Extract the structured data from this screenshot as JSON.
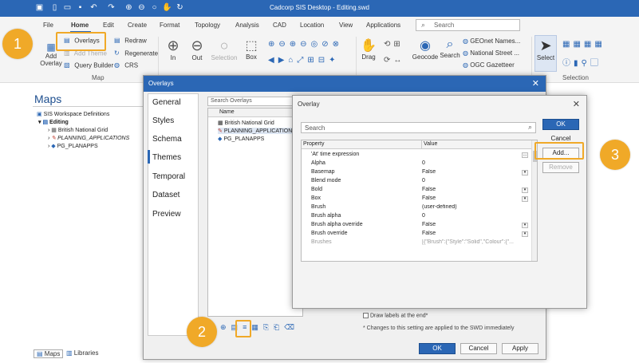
{
  "window": {
    "title": "Cadcorp SIS Desktop - Editing.swd"
  },
  "menu": {
    "items": [
      "File",
      "Home",
      "Edit",
      "Create",
      "Format",
      "Topology",
      "Analysis",
      "CAD",
      "Location",
      "View",
      "Applications"
    ],
    "active": "Home",
    "search_placeholder": "Search"
  },
  "ribbon": {
    "add_overlay": "Add\nOverlay",
    "overlays": "Overlays",
    "add_theme": "Add Theme",
    "query_builder": "Query Builder",
    "redraw": "Redraw",
    "regenerate": "Regenerate",
    "crs": "CRS",
    "map_group": "Map",
    "in": "In",
    "out": "Out",
    "selection": "Selection",
    "box": "Box",
    "drag": "Drag",
    "geocode": "Geocode",
    "search": "Search",
    "geo_items": [
      "GEOnet Names...",
      "National Street ...",
      "OGC Gazetteer"
    ],
    "select": "Select",
    "selection_group": "Selection"
  },
  "maps_panel": {
    "title": "Maps",
    "tree": [
      "SIS Workspace Definitions",
      "Editing",
      "British National Grid",
      "PLANNING_APPLICATIONS",
      "PG_PLANAPPS"
    ],
    "tabs": [
      "Maps",
      "Libraries"
    ]
  },
  "overlays_dialog": {
    "title": "Overlays",
    "nav": [
      "General",
      "Styles",
      "Schema",
      "Themes",
      "Temporal",
      "Dataset",
      "Preview"
    ],
    "selected_nav": "Themes",
    "search_placeholder": "Search Overlays",
    "list_header": "Name",
    "list_items": [
      "British National Grid",
      "PLANNING_APPLICATIONS",
      "PG_PLANAPPS"
    ],
    "draw_labels": "Draw labels at the end*",
    "note": "* Changes to this setting are applied to the SWD immediately",
    "ok": "OK",
    "cancel": "Cancel",
    "apply": "Apply"
  },
  "overlay_dialog": {
    "title": "Overlay",
    "search_placeholder": "Search",
    "col_property": "Property",
    "col_value": "Value",
    "rows": [
      {
        "p": "'At' time expression",
        "v": ""
      },
      {
        "p": "Alpha",
        "v": "0"
      },
      {
        "p": "Basemap",
        "v": "False"
      },
      {
        "p": "Blend mode",
        "v": "0"
      },
      {
        "p": "Bold",
        "v": "False"
      },
      {
        "p": "Box",
        "v": "False"
      },
      {
        "p": "Brush",
        "v": "(user-defined)"
      },
      {
        "p": "Brush alpha",
        "v": "0"
      },
      {
        "p": "Brush alpha override",
        "v": "False"
      },
      {
        "p": "Brush override",
        "v": "False"
      },
      {
        "p": "Brushes",
        "v": "[{\"Brush\":{\"Style\":\"Solid\",\"Colour\":{\"..."
      }
    ],
    "ok": "OK",
    "cancel": "Cancel",
    "add": "Add...",
    "remove": "Remove"
  },
  "callouts": [
    "1",
    "2",
    "3"
  ],
  "colors": {
    "accent": "#2b67b5",
    "callout": "#f0a928"
  }
}
